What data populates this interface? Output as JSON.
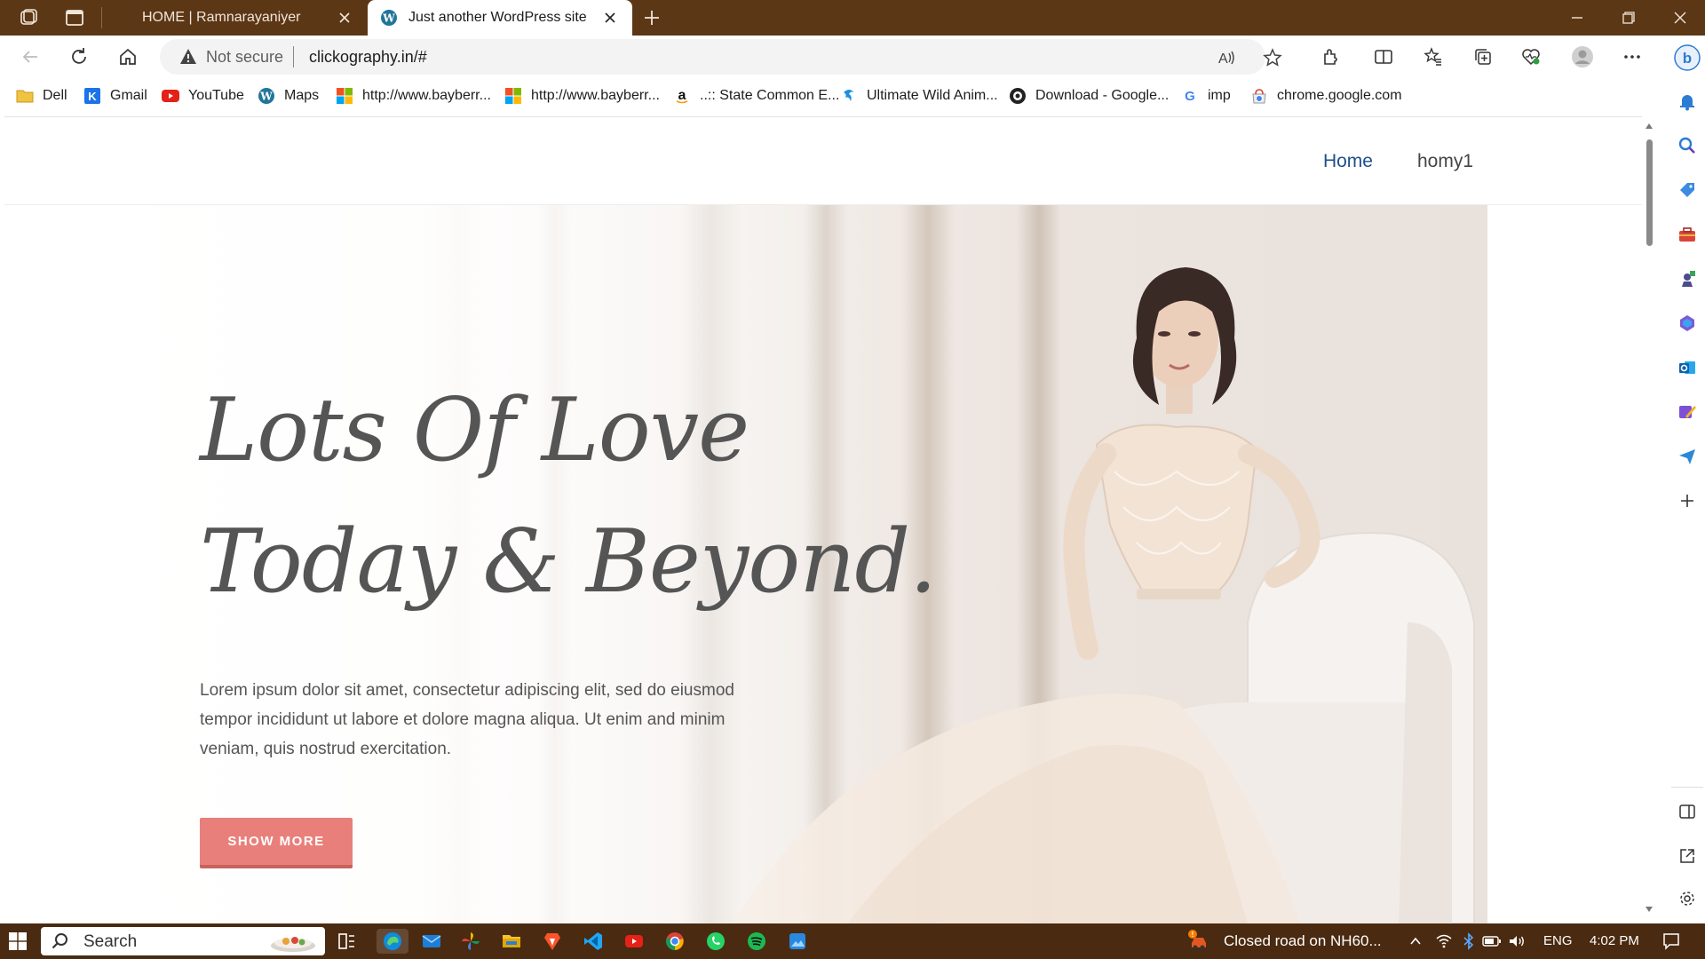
{
  "browser": {
    "tabs": [
      {
        "title": "HOME | Ramnarayaniyer",
        "active": false
      },
      {
        "title": "Just another WordPress site",
        "active": true
      }
    ],
    "address": {
      "security_label": "Not secure",
      "url": "clickography.in/#"
    },
    "bookmarks": [
      {
        "label": "Dell",
        "icon": "folder-icon"
      },
      {
        "label": "Gmail",
        "icon": "gmail-icon"
      },
      {
        "label": "YouTube",
        "icon": "youtube-icon"
      },
      {
        "label": "Maps",
        "icon": "wordpress-icon"
      },
      {
        "label": "http://www.bayberr...",
        "icon": "microsoft-icon"
      },
      {
        "label": "http://www.bayberr...",
        "icon": "microsoft-icon"
      },
      {
        "label": "..:: State Common E...",
        "icon": "amazon-icon"
      },
      {
        "label": "Ultimate Wild Anim...",
        "icon": "swirl-icon"
      },
      {
        "label": "Download - Google...",
        "icon": "globe-icon"
      },
      {
        "label": "imp",
        "icon": "google-icon"
      },
      {
        "label": "chrome.google.com",
        "icon": "chrome-store-icon"
      }
    ]
  },
  "site": {
    "nav": {
      "home": "Home",
      "item2": "homy1"
    },
    "hero": {
      "title_line1": "Lots Of Love",
      "title_line2": "Today & Beyond.",
      "text": "Lorem ipsum dolor sit amet, consectetur adipiscing elit, sed do eiusmod tempor incididunt ut labore et dolore magna aliqua. Ut enim and minim veniam, quis nostrud exercitation.",
      "button": "SHOW MORE"
    }
  },
  "taskbar": {
    "search_label": "Search",
    "news": "Closed road on NH60...",
    "language": "ENG",
    "time": "4:02 PM"
  },
  "colors": {
    "titlebar": "#5b3716",
    "taskbar": "#4a2a10",
    "accent_button": "#e97f7a",
    "nav_active": "#1f4e8c"
  }
}
